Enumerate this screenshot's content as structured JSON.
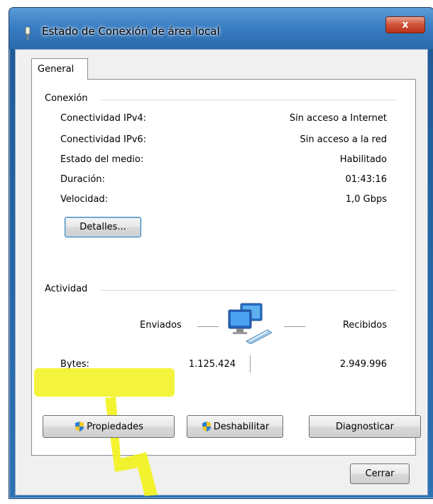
{
  "window": {
    "title": "Estado de Conexión de área local",
    "close_glyph": "x"
  },
  "tabs": [
    {
      "label": "General"
    }
  ],
  "connection": {
    "group_title": "Conexión",
    "rows": [
      {
        "label": "Conectividad IPv4:",
        "value": "Sin acceso a Internet"
      },
      {
        "label": "Conectividad IPv6:",
        "value": "Sin acceso a la red"
      },
      {
        "label": "Estado del medio:",
        "value": "Habilitado"
      },
      {
        "label": "Duración:",
        "value": "01:43:16"
      },
      {
        "label": "Velocidad:",
        "value": "1,0 Gbps"
      }
    ],
    "details_button": "Detalles..."
  },
  "activity": {
    "group_title": "Actividad",
    "sent_label": "Enviados",
    "received_label": "Recibidos",
    "bytes_label": "Bytes:",
    "bytes_sent": "1.125.424",
    "bytes_received": "2.949.996"
  },
  "buttons": {
    "properties": "Propiedades",
    "disable": "Deshabilitar",
    "diagnose": "Diagnosticar",
    "close": "Cerrar"
  },
  "icons": {
    "title": "network-adapter-icon",
    "activity": "network-computers-icon",
    "shield": "uac-shield-icon"
  },
  "colors": {
    "annotation_highlight": "#f2f21a",
    "title_bar": "#3a7ec4",
    "close_button": "#c7432a"
  }
}
